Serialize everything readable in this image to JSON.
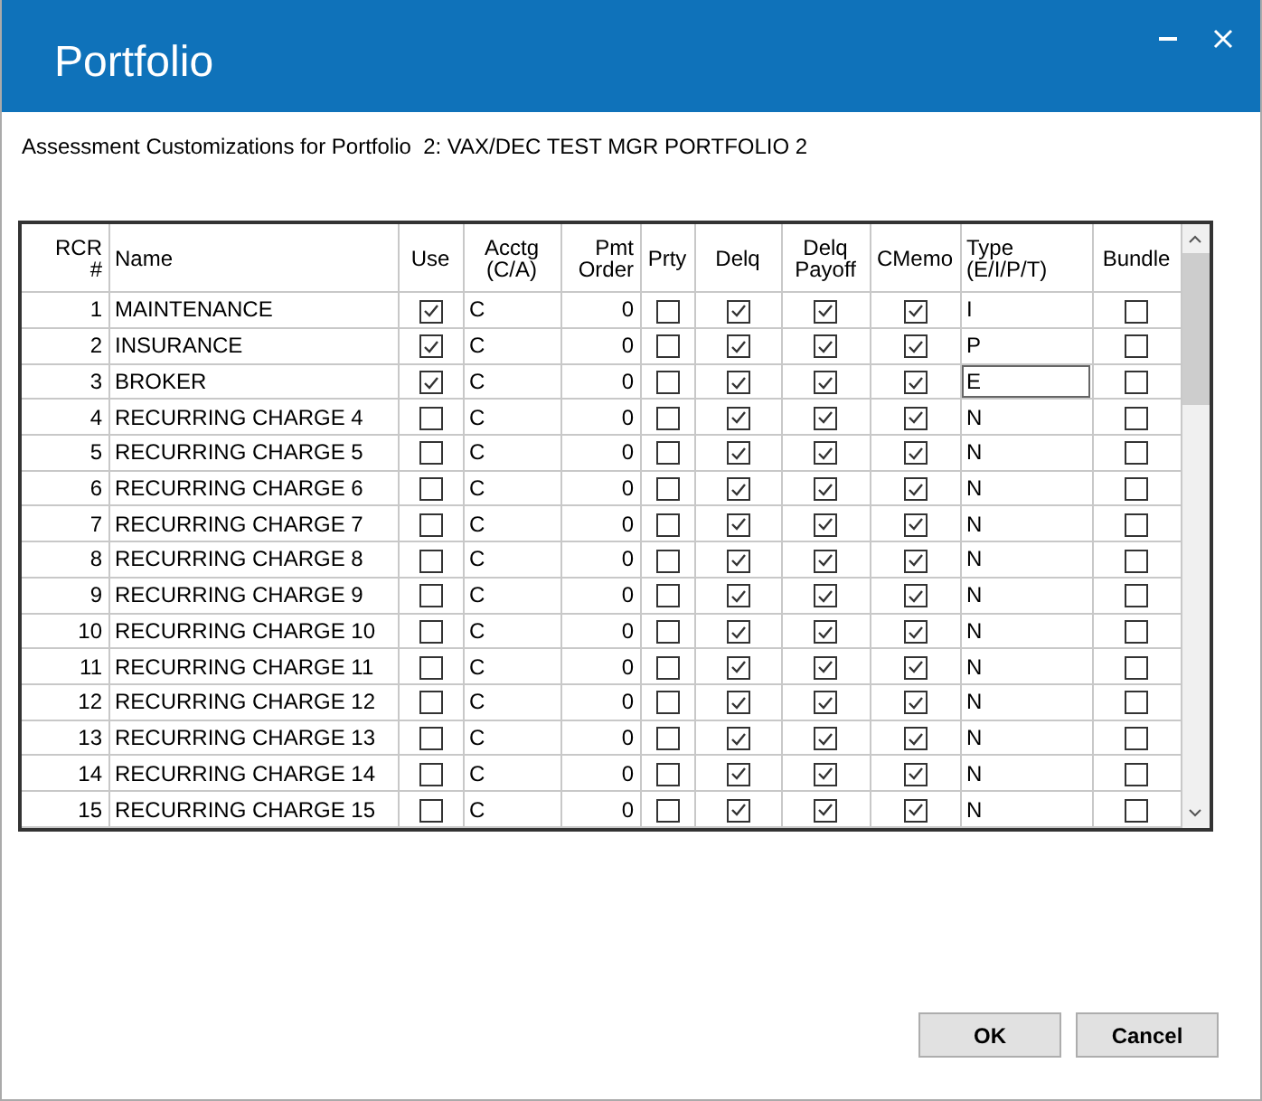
{
  "window": {
    "title": "Portfolio"
  },
  "subtitle": "Assessment Customizations for Portfolio  2: VAX/DEC TEST MGR PORTFOLIO 2",
  "columns": [
    "RCR\n#",
    "Name",
    "Use",
    "Acctg\n(C/A)",
    "Pmt\nOrder",
    "Prty",
    "Delq",
    "Delq\nPayoff",
    "CMemo",
    "Type\n(E/I/P/T)",
    "Bundle"
  ],
  "rows": [
    {
      "rcr": "1",
      "name": "MAINTENANCE",
      "use": true,
      "acctg": "C",
      "pmt_order": "0",
      "prty": false,
      "delq": true,
      "delq_payoff": true,
      "cmemo": true,
      "type": "I",
      "type_focused": false,
      "bundle": false
    },
    {
      "rcr": "2",
      "name": "INSURANCE",
      "use": true,
      "acctg": "C",
      "pmt_order": "0",
      "prty": false,
      "delq": true,
      "delq_payoff": true,
      "cmemo": true,
      "type": "P",
      "type_focused": false,
      "bundle": false
    },
    {
      "rcr": "3",
      "name": "BROKER",
      "use": true,
      "acctg": "C",
      "pmt_order": "0",
      "prty": false,
      "delq": true,
      "delq_payoff": true,
      "cmemo": true,
      "type": "E",
      "type_focused": true,
      "bundle": false
    },
    {
      "rcr": "4",
      "name": "RECURRING CHARGE 4",
      "use": false,
      "acctg": "C",
      "pmt_order": "0",
      "prty": false,
      "delq": true,
      "delq_payoff": true,
      "cmemo": true,
      "type": "N",
      "type_focused": false,
      "bundle": false
    },
    {
      "rcr": "5",
      "name": "RECURRING CHARGE 5",
      "use": false,
      "acctg": "C",
      "pmt_order": "0",
      "prty": false,
      "delq": true,
      "delq_payoff": true,
      "cmemo": true,
      "type": "N",
      "type_focused": false,
      "bundle": false
    },
    {
      "rcr": "6",
      "name": "RECURRING CHARGE 6",
      "use": false,
      "acctg": "C",
      "pmt_order": "0",
      "prty": false,
      "delq": true,
      "delq_payoff": true,
      "cmemo": true,
      "type": "N",
      "type_focused": false,
      "bundle": false
    },
    {
      "rcr": "7",
      "name": "RECURRING CHARGE 7",
      "use": false,
      "acctg": "C",
      "pmt_order": "0",
      "prty": false,
      "delq": true,
      "delq_payoff": true,
      "cmemo": true,
      "type": "N",
      "type_focused": false,
      "bundle": false
    },
    {
      "rcr": "8",
      "name": "RECURRING CHARGE 8",
      "use": false,
      "acctg": "C",
      "pmt_order": "0",
      "prty": false,
      "delq": true,
      "delq_payoff": true,
      "cmemo": true,
      "type": "N",
      "type_focused": false,
      "bundle": false
    },
    {
      "rcr": "9",
      "name": "RECURRING CHARGE 9",
      "use": false,
      "acctg": "C",
      "pmt_order": "0",
      "prty": false,
      "delq": true,
      "delq_payoff": true,
      "cmemo": true,
      "type": "N",
      "type_focused": false,
      "bundle": false
    },
    {
      "rcr": "10",
      "name": "RECURRING CHARGE 10",
      "use": false,
      "acctg": "C",
      "pmt_order": "0",
      "prty": false,
      "delq": true,
      "delq_payoff": true,
      "cmemo": true,
      "type": "N",
      "type_focused": false,
      "bundle": false
    },
    {
      "rcr": "11",
      "name": "RECURRING CHARGE 11",
      "use": false,
      "acctg": "C",
      "pmt_order": "0",
      "prty": false,
      "delq": true,
      "delq_payoff": true,
      "cmemo": true,
      "type": "N",
      "type_focused": false,
      "bundle": false
    },
    {
      "rcr": "12",
      "name": "RECURRING CHARGE 12",
      "use": false,
      "acctg": "C",
      "pmt_order": "0",
      "prty": false,
      "delq": true,
      "delq_payoff": true,
      "cmemo": true,
      "type": "N",
      "type_focused": false,
      "bundle": false
    },
    {
      "rcr": "13",
      "name": "RECURRING CHARGE 13",
      "use": false,
      "acctg": "C",
      "pmt_order": "0",
      "prty": false,
      "delq": true,
      "delq_payoff": true,
      "cmemo": true,
      "type": "N",
      "type_focused": false,
      "bundle": false
    },
    {
      "rcr": "14",
      "name": "RECURRING CHARGE 14",
      "use": false,
      "acctg": "C",
      "pmt_order": "0",
      "prty": false,
      "delq": true,
      "delq_payoff": true,
      "cmemo": true,
      "type": "N",
      "type_focused": false,
      "bundle": false
    },
    {
      "rcr": "15",
      "name": "RECURRING CHARGE 15",
      "use": false,
      "acctg": "C",
      "pmt_order": "0",
      "prty": false,
      "delq": true,
      "delq_payoff": true,
      "cmemo": true,
      "type": "N",
      "type_focused": false,
      "bundle": false
    }
  ],
  "buttons": [
    "OK",
    "Cancel"
  ]
}
